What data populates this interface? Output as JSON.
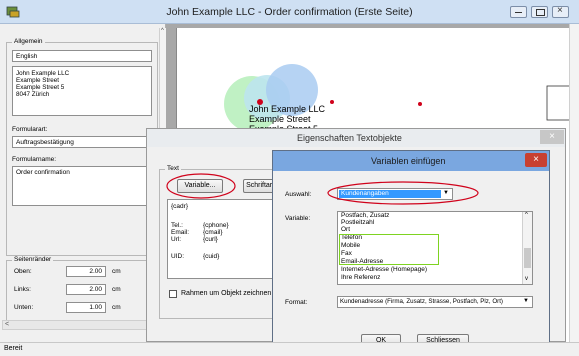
{
  "window": {
    "title": "John Example LLC - Order confirmation  (Erste Seite)",
    "status": "Bereit"
  },
  "left_panel": {
    "allgemein_label": "Allgemein",
    "language": "English",
    "address_lines": [
      "John Example LLC",
      "Example Street",
      "Example Street 5",
      "8047 Zürich"
    ],
    "formularart_label": "Formularart:",
    "formularart_value": "Auftragsbestätigung",
    "formularname_label": "Formularname:",
    "formularname_value": "Order confirmation",
    "seitenraender_label": "Seitenränder",
    "margins": [
      {
        "label": "Oben:",
        "value": "2.00",
        "unit": "cm"
      },
      {
        "label": "Links:",
        "value": "2.00",
        "unit": "cm"
      },
      {
        "label": "Unten:",
        "value": "1.00",
        "unit": "cm"
      }
    ]
  },
  "preview": {
    "address_lines": [
      "John Example LLC",
      "Example Street",
      "Example Street 5"
    ]
  },
  "dialog_text_objects": {
    "title": "Eigenschaften Textobjekte",
    "text_group_label": "Text",
    "variable_button": "Variable...",
    "font_button": "Schriftart...",
    "content": {
      "cadr": "{cadr}",
      "rows": [
        {
          "label": "Tel.:",
          "value": "{cphone}"
        },
        {
          "label": "Email:",
          "value": "{cmail}"
        },
        {
          "label": "Url:",
          "value": "{curl}"
        }
      ],
      "uid_label": "UID:",
      "uid_value": "{cuid}"
    },
    "frame_checkbox_label": "Rahmen um Objekt zeichnen"
  },
  "dialog_insert_variables": {
    "title": "Variablen einfügen",
    "auswahl_label": "Auswahl:",
    "auswahl_value": "Kundenangaben",
    "variable_label": "Variable:",
    "variables": [
      "Postfach, Zusatz",
      "Postleitzahl",
      "Ort",
      "Telefon",
      "Mobile",
      "Fax",
      "Email-Adresse",
      "Internet-Adresse (Homepage)",
      "Ihre Referenz"
    ],
    "format_label": "Format:",
    "format_value": "Kundenadresse (Firma, Zusatz, Strasse, Postfach, Plz, Ort)",
    "ok_button": "OK",
    "close_button": "Schliessen"
  },
  "colors": {
    "highlight_red": "#d0021b",
    "highlight_green": "#7ed321",
    "selection_blue": "#3399ff",
    "dialog_title_blue": "#7aa7e0"
  }
}
